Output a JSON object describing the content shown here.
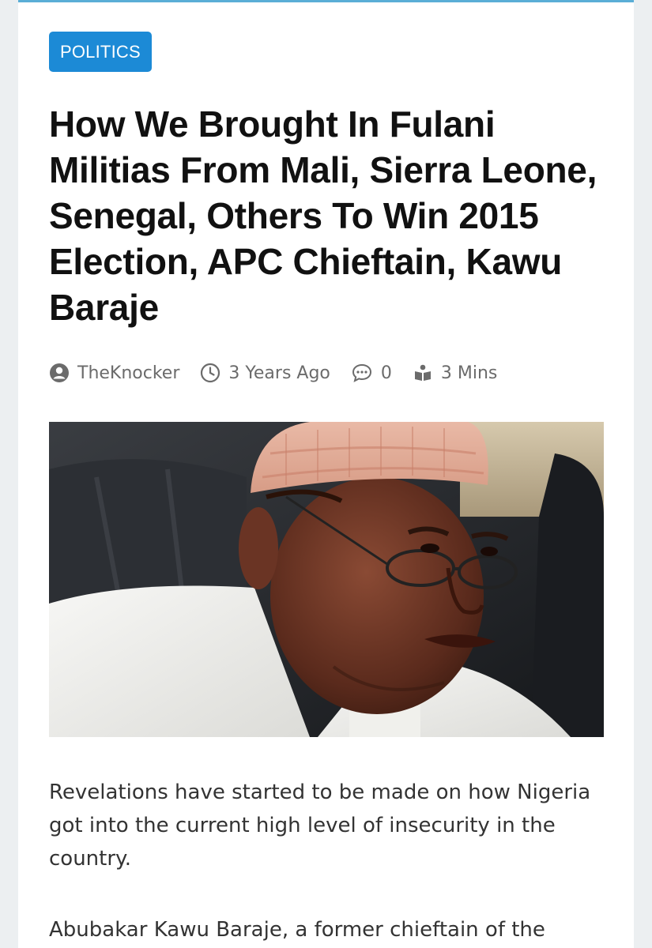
{
  "article": {
    "category": "POLITICS",
    "headline": "How We Brought In Fulani Militias From Mali, Sierra Leone, Senegal, Others To Win 2015 Election, APC Chieftain, Kawu Baraje",
    "meta": {
      "author": "TheKnocker",
      "date": "3 Years Ago",
      "comments": "0",
      "read_time": "3 Mins"
    },
    "image": {
      "subject": "portrait of a man wearing a patterned cap and glasses"
    },
    "paragraphs": [
      "Revelations have started to be made on how Nigeria got into the current high level of insecurity in the country.",
      "Abubakar Kawu Baraje, a former chieftain of the"
    ]
  },
  "colors": {
    "accent": "#1c8ad6",
    "headline": "#111111",
    "meta": "#6b6b6b",
    "body_text": "#333333"
  },
  "icons": {
    "author": "user-circle-icon",
    "date": "clock-icon",
    "comments": "comment-bubble-icon",
    "read_time": "reader-icon"
  }
}
